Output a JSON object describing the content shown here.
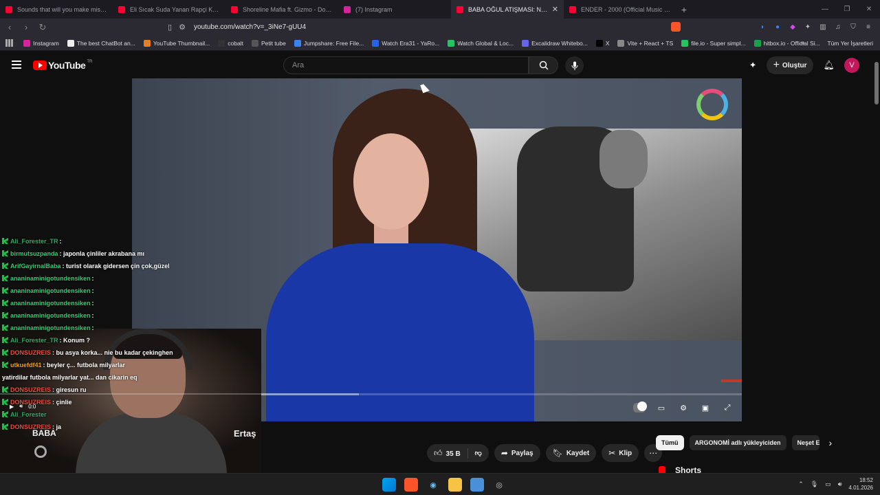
{
  "browser": {
    "tabs": [
      {
        "title": "Sounds that will you make miss Japa",
        "color": "#ff0033"
      },
      {
        "title": "Eli Sıcak Suda Yanan Rapçi Kız :) - Yo",
        "color": "#ff0033"
      },
      {
        "title": "Shoreline Mafia ft. Gizmo - Double S",
        "color": "#ff0033"
      },
      {
        "title": "(7) Instagram",
        "color": "#d6249f"
      },
      {
        "title": "BABA OĞUL ATIŞMASI: Neşet Er",
        "color": "#ff0033",
        "active": true
      },
      {
        "title": "ENDER - 2000 (Official Music Video)",
        "color": "#ff0033"
      }
    ],
    "url": "youtube.com/watch?v=_3iNe7-gUU4",
    "bookmarks": [
      {
        "label": "Instagram",
        "color": "#d6249f"
      },
      {
        "label": "The best ChatBot an...",
        "color": "#eeeeee"
      },
      {
        "label": "YouTube Thumbnail...",
        "color": "#e67e22"
      },
      {
        "label": "cobalt",
        "color": "#333333"
      },
      {
        "label": "Petit tube",
        "color": "#555555"
      },
      {
        "label": "Jumpshare: Free File...",
        "color": "#3b82f6"
      },
      {
        "label": "Watch Era31 - YaRo...",
        "color": "#2563eb"
      },
      {
        "label": "Watch Global & Loc...",
        "color": "#22c55e"
      },
      {
        "label": "Excalidraw Whitebo...",
        "color": "#6366f1"
      },
      {
        "label": "X",
        "color": "#000000"
      },
      {
        "label": "Vite + React + TS",
        "color": "#888888"
      },
      {
        "label": "file.io - Super simpl...",
        "color": "#22c55e"
      },
      {
        "label": "hitbox.io - Official Si...",
        "color": "#16a34a"
      }
    ],
    "all_bookmarks": "Tüm Yer İşaretleri"
  },
  "youtube": {
    "logo_text": "YouTube",
    "country": "TR",
    "search_placeholder": "Ara",
    "create_label": "Oluştur",
    "avatar_letter": "V",
    "video_title_left": "BABA",
    "video_title_right": "Ertaş",
    "actions": {
      "likes": "35 B",
      "share": "Paylaş",
      "save": "Kaydet",
      "clip": "Klip"
    },
    "chips": [
      "Tümü",
      "ARGONOMİ adlı yükleyiciden",
      "Neşet Er"
    ],
    "shorts_label": "Shorts",
    "time": "0:0"
  },
  "chat": [
    {
      "user": "Ali_Forester_TR",
      "text": ":",
      "color": "#27ae60"
    },
    {
      "user": "birmutsuzpanda",
      "text": ": japonla çinliler akrabana mı",
      "color": "#2ecc71"
    },
    {
      "user": "ArifGayirnalBaba",
      "text": ": turist olarak gidersen çin çok,güzel",
      "color": "#2ecc71"
    },
    {
      "user": "ananinaminigotundensiken",
      "text": ":",
      "color": "#2ecc71"
    },
    {
      "user": "ananinaminigotundensiken",
      "text": ":",
      "color": "#2ecc71"
    },
    {
      "user": "ananinaminigotundensiken",
      "text": ":",
      "color": "#2ecc71"
    },
    {
      "user": "ananinaminigotundensiken",
      "text": ":",
      "color": "#2ecc71"
    },
    {
      "user": "ananinaminigotundensiken",
      "text": ":",
      "color": "#2ecc71"
    },
    {
      "user": "Ali_Forester_TR",
      "text": ": Konum ?",
      "color": "#27ae60"
    },
    {
      "user": "DONSUZREIS",
      "text": ": bu asya korka...  nie bu kadar çekinghen",
      "color": "#e74c3c"
    },
    {
      "user": "utkuefdf41",
      "text": ": beyler ç...  futbola milyarlar",
      "color": "#f39c12"
    },
    {
      "user": "",
      "text": "yatirdilar futbola milyarlar yat...  dan cikarin eq",
      "color": "#ffffff"
    },
    {
      "user": "DONSUZREIS",
      "text": ": giresun ru",
      "color": "#e74c3c"
    },
    {
      "user": "DONSUZREIS",
      "text": ": çinlie",
      "color": "#e74c3c"
    },
    {
      "user": "Ali_Forester",
      "text": "",
      "color": "#27ae60"
    },
    {
      "user": "DONSUZREIS",
      "text": ": ja",
      "color": "#e74c3c"
    }
  ],
  "taskbar": {
    "time": "18:52",
    "date": "4.01.2026"
  }
}
